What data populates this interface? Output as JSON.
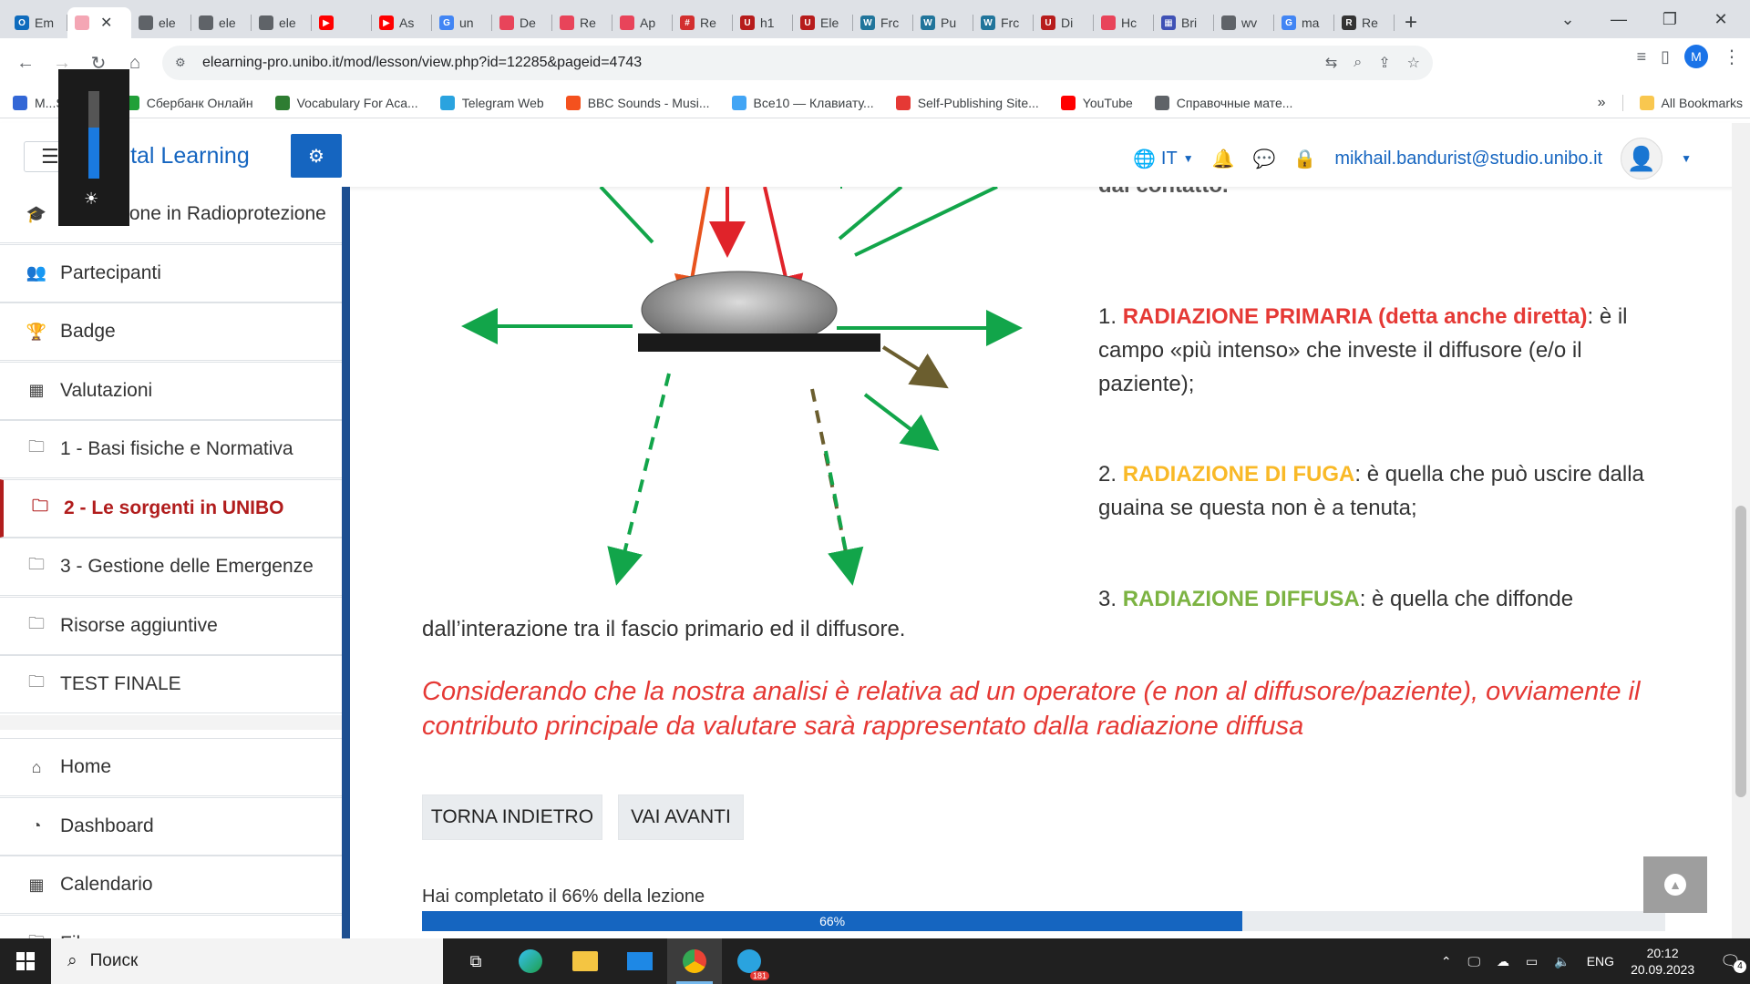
{
  "browser": {
    "tabs": [
      {
        "label": "Em",
        "color": "#0f6cbd",
        "glyph": "O"
      },
      {
        "label": "",
        "color": "#f4a6b4",
        "glyph": "",
        "active": true
      },
      {
        "label": "ele",
        "color": "#5f6368",
        "glyph": ""
      },
      {
        "label": "ele",
        "color": "#5f6368",
        "glyph": ""
      },
      {
        "label": "ele",
        "color": "#5f6368",
        "glyph": ""
      },
      {
        "label": "",
        "color": "#ff0000",
        "glyph": "▶"
      },
      {
        "label": "As",
        "color": "#ff0000",
        "glyph": "▶"
      },
      {
        "label": "un",
        "color": "#4285f4",
        "glyph": "G"
      },
      {
        "label": "De",
        "color": "#e8445a",
        "glyph": ""
      },
      {
        "label": "Re",
        "color": "#e8445a",
        "glyph": ""
      },
      {
        "label": "Ap",
        "color": "#e8445a",
        "glyph": ""
      },
      {
        "label": "Re",
        "color": "#d32f2f",
        "glyph": "#"
      },
      {
        "label": "h1",
        "color": "#b71c1c",
        "glyph": "U"
      },
      {
        "label": "Ele",
        "color": "#b71c1c",
        "glyph": "U"
      },
      {
        "label": "Frc",
        "color": "#21759b",
        "glyph": "W"
      },
      {
        "label": "Pu",
        "color": "#21759b",
        "glyph": "W"
      },
      {
        "label": "Frc",
        "color": "#21759b",
        "glyph": "W"
      },
      {
        "label": "Di",
        "color": "#b71c1c",
        "glyph": "U"
      },
      {
        "label": "Hc",
        "color": "#e8445a",
        "glyph": ""
      },
      {
        "label": "Bri",
        "color": "#3f51b5",
        "glyph": "▦"
      },
      {
        "label": "wv",
        "color": "#5f6368",
        "glyph": ""
      },
      {
        "label": "ma",
        "color": "#4285f4",
        "glyph": "G"
      },
      {
        "label": "Re",
        "color": "#333333",
        "glyph": "R"
      }
    ],
    "url": "elearning-pro.unibo.it/mod/lesson/view.php?id=12285&pageid=4743",
    "profile_initial": "M",
    "bookmarks": [
      {
        "label": "M...Studie...",
        "color": "#3367d6"
      },
      {
        "label": "Сбербанк Онлайн",
        "color": "#21a038"
      },
      {
        "label": "Vocabulary For Aca...",
        "color": "#2e7d32"
      },
      {
        "label": "Telegram Web",
        "color": "#2aa3df"
      },
      {
        "label": "BBC Sounds - Musi...",
        "color": "#f4511e"
      },
      {
        "label": "Все10 — Клавиату...",
        "color": "#42a5f5"
      },
      {
        "label": "Self-Publishing Site...",
        "color": "#e53935"
      },
      {
        "label": "YouTube",
        "color": "#ff0000"
      },
      {
        "label": "Справочные мате...",
        "color": "#5f6368"
      }
    ],
    "bookmarks_more": "»",
    "all_bookmarks": "All Bookmarks"
  },
  "site": {
    "brand": "Digital Learning",
    "lang": "IT",
    "user_email": "mikhail.bandurist@studio.unibo.it"
  },
  "sidebar": {
    "items": [
      {
        "label": "Formazione in Radioprotezione",
        "icon": "🎓",
        "name": "graduation-cap-icon"
      },
      {
        "label": "Partecipanti",
        "icon": "👥",
        "name": "users-icon"
      },
      {
        "label": "Badge",
        "icon": "🏆",
        "name": "trophy-icon"
      },
      {
        "label": "Valutazioni",
        "icon": "▦",
        "name": "table-icon"
      },
      {
        "label": "1 - Basi fisiche e Normativa",
        "icon": "🗀",
        "name": "folder-icon"
      },
      {
        "label": "2 - Le sorgenti in UNIBO",
        "icon": "🗀",
        "name": "folder-icon",
        "active": true
      },
      {
        "label": "3 - Gestione delle Emergenze",
        "icon": "🗀",
        "name": "folder-icon"
      },
      {
        "label": "Risorse aggiuntive",
        "icon": "🗀",
        "name": "folder-icon"
      },
      {
        "label": "TEST FINALE",
        "icon": "🗀",
        "name": "folder-icon"
      }
    ],
    "bottom_items": [
      {
        "label": "Home",
        "icon": "⌂",
        "name": "home-icon"
      },
      {
        "label": "Dashboard",
        "icon": "◔",
        "name": "dashboard-icon"
      },
      {
        "label": "Calendario",
        "icon": "▦",
        "name": "calendar-icon"
      },
      {
        "label": "File...",
        "icon": "🗀",
        "name": "file-icon"
      }
    ]
  },
  "content": {
    "cutoff_text": "dal contatto.",
    "item1_num": "1. ",
    "item1_title": "RADIAZIONE PRIMARIA (detta anche diretta)",
    "item1_body": ": è il campo «più intenso» che investe il diffusore (e/o il paziente);",
    "item2_num": "2. ",
    "item2_title": "RADIAZIONE DI FUGA",
    "item2_body": ": è quella che può uscire dalla guaina se questa non è a tenuta;",
    "item3_num": "3. ",
    "item3_title": "RADIAZIONE DIFFUSA",
    "item3_body": ": è quella che diffonde",
    "item3_continued": "dall’interazione tra il fascio primario ed il diffusore.",
    "note": "Considerando che la nostra analisi è relativa ad un operatore (e non al diffusore/paziente), ovviamente il contributo principale da valutare sarà rappresentato dalla radiazione diffusa",
    "btn_back": "TORNA INDIETRO",
    "btn_next": "VAI AVANTI",
    "progress_label": "Hai completato il 66% della lezione",
    "progress_text": "66%",
    "progress_value": 0.66
  },
  "taskbar": {
    "search_placeholder": "Поиск",
    "lang": "ENG",
    "time": "20:12",
    "date": "20.09.2023",
    "notifications": "4",
    "telegram_badge": "181"
  },
  "colors": {
    "primary_blue": "#1565c0",
    "red": "#e53935",
    "yellow": "#f9b927",
    "green": "#7cb342",
    "active_red": "#b11d1d"
  }
}
